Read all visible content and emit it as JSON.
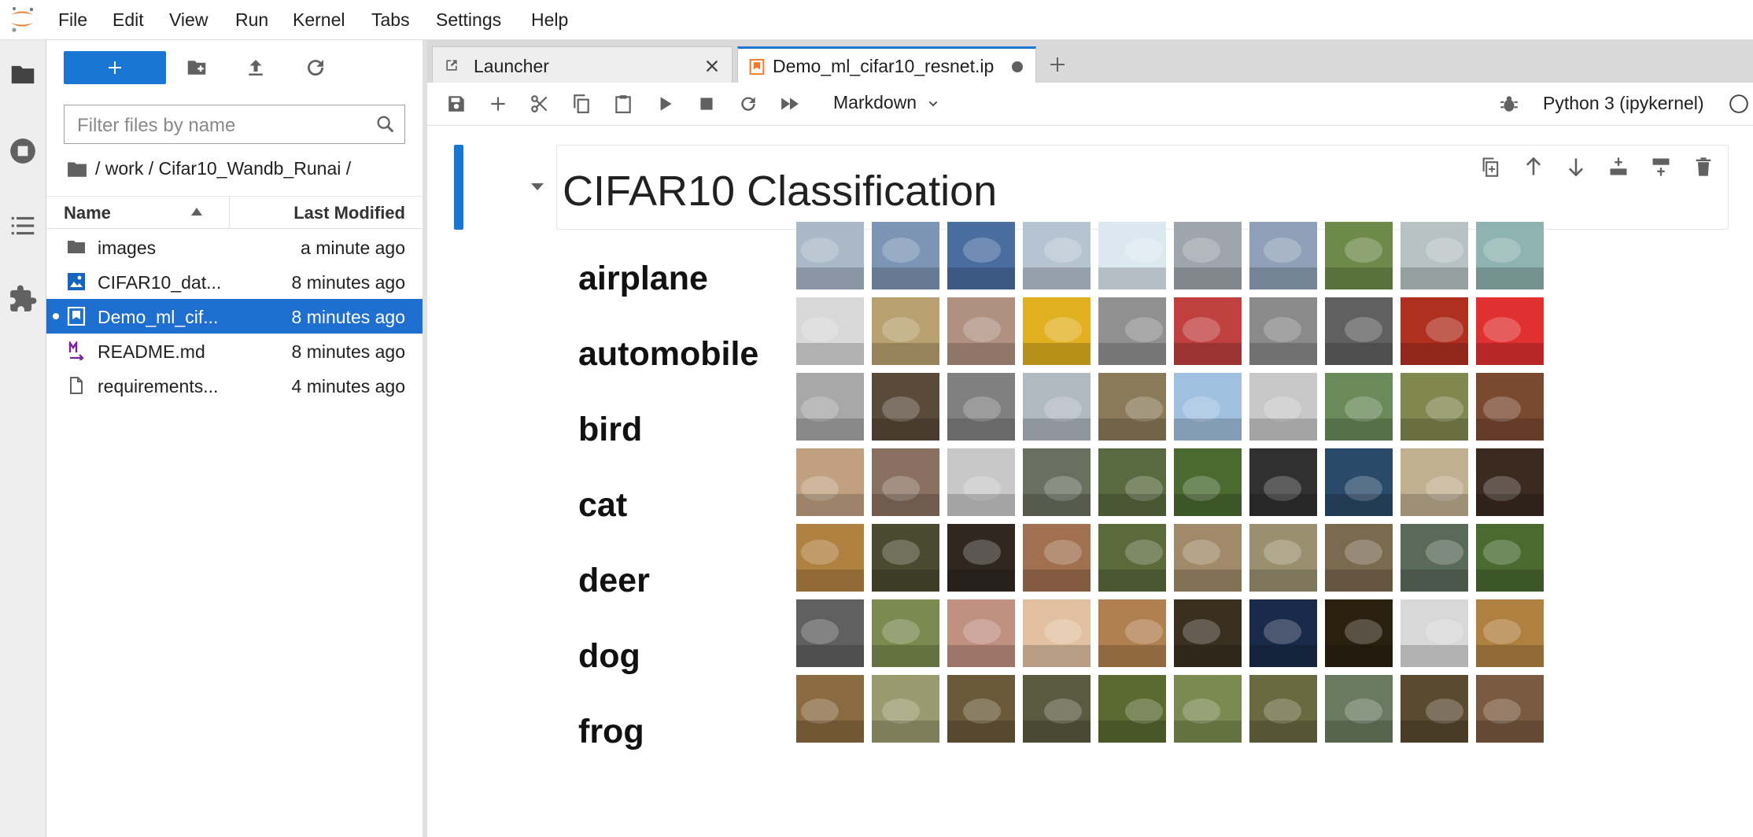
{
  "menubar": {
    "items": [
      "File",
      "Edit",
      "View",
      "Run",
      "Kernel",
      "Tabs",
      "Settings",
      "Help"
    ]
  },
  "filebrowser": {
    "filter_placeholder": "Filter files by name",
    "breadcrumb": "/ work / Cifar10_Wandb_Runai /",
    "col_name": "Name",
    "col_modified": "Last Modified",
    "files": [
      {
        "name": "images",
        "modified": "a minute ago",
        "icon": "folder-icon"
      },
      {
        "name": "CIFAR10_dat...",
        "modified": "8 minutes ago",
        "icon": "image-file-icon"
      },
      {
        "name": "Demo_ml_cif...",
        "modified": "8 minutes ago",
        "icon": "notebook-icon"
      },
      {
        "name": "README.md",
        "modified": "8 minutes ago",
        "icon": "markdown-icon"
      },
      {
        "name": "requirements...",
        "modified": "4 minutes ago",
        "icon": "file-icon"
      }
    ]
  },
  "tabs": [
    {
      "label": "Launcher"
    },
    {
      "label": "Demo_ml_cifar10_resnet.ip"
    }
  ],
  "toolbar": {
    "cell_type": "Markdown",
    "kernel": "Python 3 (ipykernel)"
  },
  "notebook": {
    "heading": "CIFAR10 Classification",
    "classes": [
      "airplane",
      "automobile",
      "bird",
      "cat",
      "deer",
      "dog",
      "frog"
    ]
  },
  "colors": {
    "accent": "#1976d2",
    "selected_row": "#1e6fcf"
  }
}
